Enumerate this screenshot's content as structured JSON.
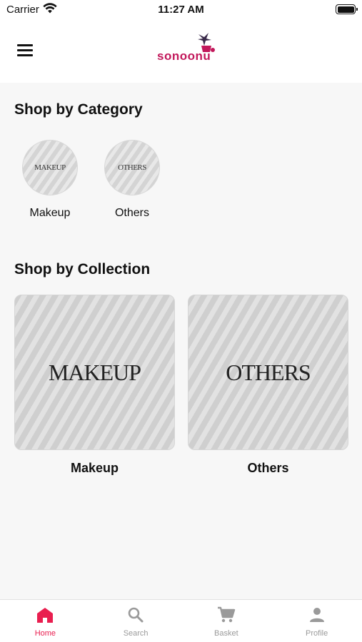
{
  "status_bar": {
    "carrier": "Carrier",
    "time": "11:27 AM"
  },
  "header": {
    "brand": "sonoonu",
    "brand_color": "#c2185b"
  },
  "category_section": {
    "title": "Shop by Category",
    "items": [
      {
        "image_text": "MAKEUP",
        "label": "Makeup"
      },
      {
        "image_text": "OTHERS",
        "label": "Others"
      }
    ]
  },
  "collection_section": {
    "title": "Shop by Collection",
    "items": [
      {
        "image_text": "MAKEUP",
        "label": "Makeup"
      },
      {
        "image_text": "OTHERS",
        "label": "Others"
      }
    ]
  },
  "tab_bar": {
    "active_color": "#e91e4f",
    "inactive_color": "#9a9a9a",
    "tabs": [
      {
        "label": "Home",
        "icon": "home-icon",
        "active": true
      },
      {
        "label": "Search",
        "icon": "search-icon",
        "active": false
      },
      {
        "label": "Basket",
        "icon": "cart-icon",
        "active": false
      },
      {
        "label": "Profile",
        "icon": "person-icon",
        "active": false
      }
    ]
  }
}
